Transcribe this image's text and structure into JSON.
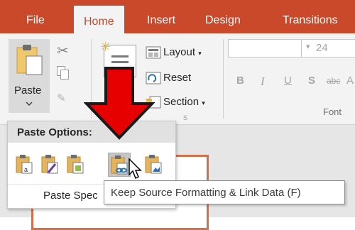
{
  "tabs": [
    "File",
    "Home",
    "Insert",
    "Design",
    "Transitions"
  ],
  "ribbon": {
    "paste_label": "Paste",
    "layout_label": "Layout",
    "reset_label": "Reset",
    "section_label": "Section",
    "font_size": "24",
    "font_group_label": "Font",
    "slides_group_fragment": "s"
  },
  "paste_options": {
    "title": "Paste Options:",
    "paste_special_label": "Paste Spec",
    "options": [
      {
        "icon": "use-destination-theme-icon"
      },
      {
        "icon": "keep-source-formatting-icon"
      },
      {
        "icon": "embed-icon"
      },
      {
        "icon": "keep-source-formatting-link-data-icon"
      },
      {
        "icon": "picture-icon"
      }
    ]
  },
  "tooltip": {
    "text": "Keep Source Formatting & Link Data (F)"
  },
  "colors": {
    "accent": "#c9492a",
    "arrow": "#e60000",
    "link_blue": "#2e75b6"
  }
}
